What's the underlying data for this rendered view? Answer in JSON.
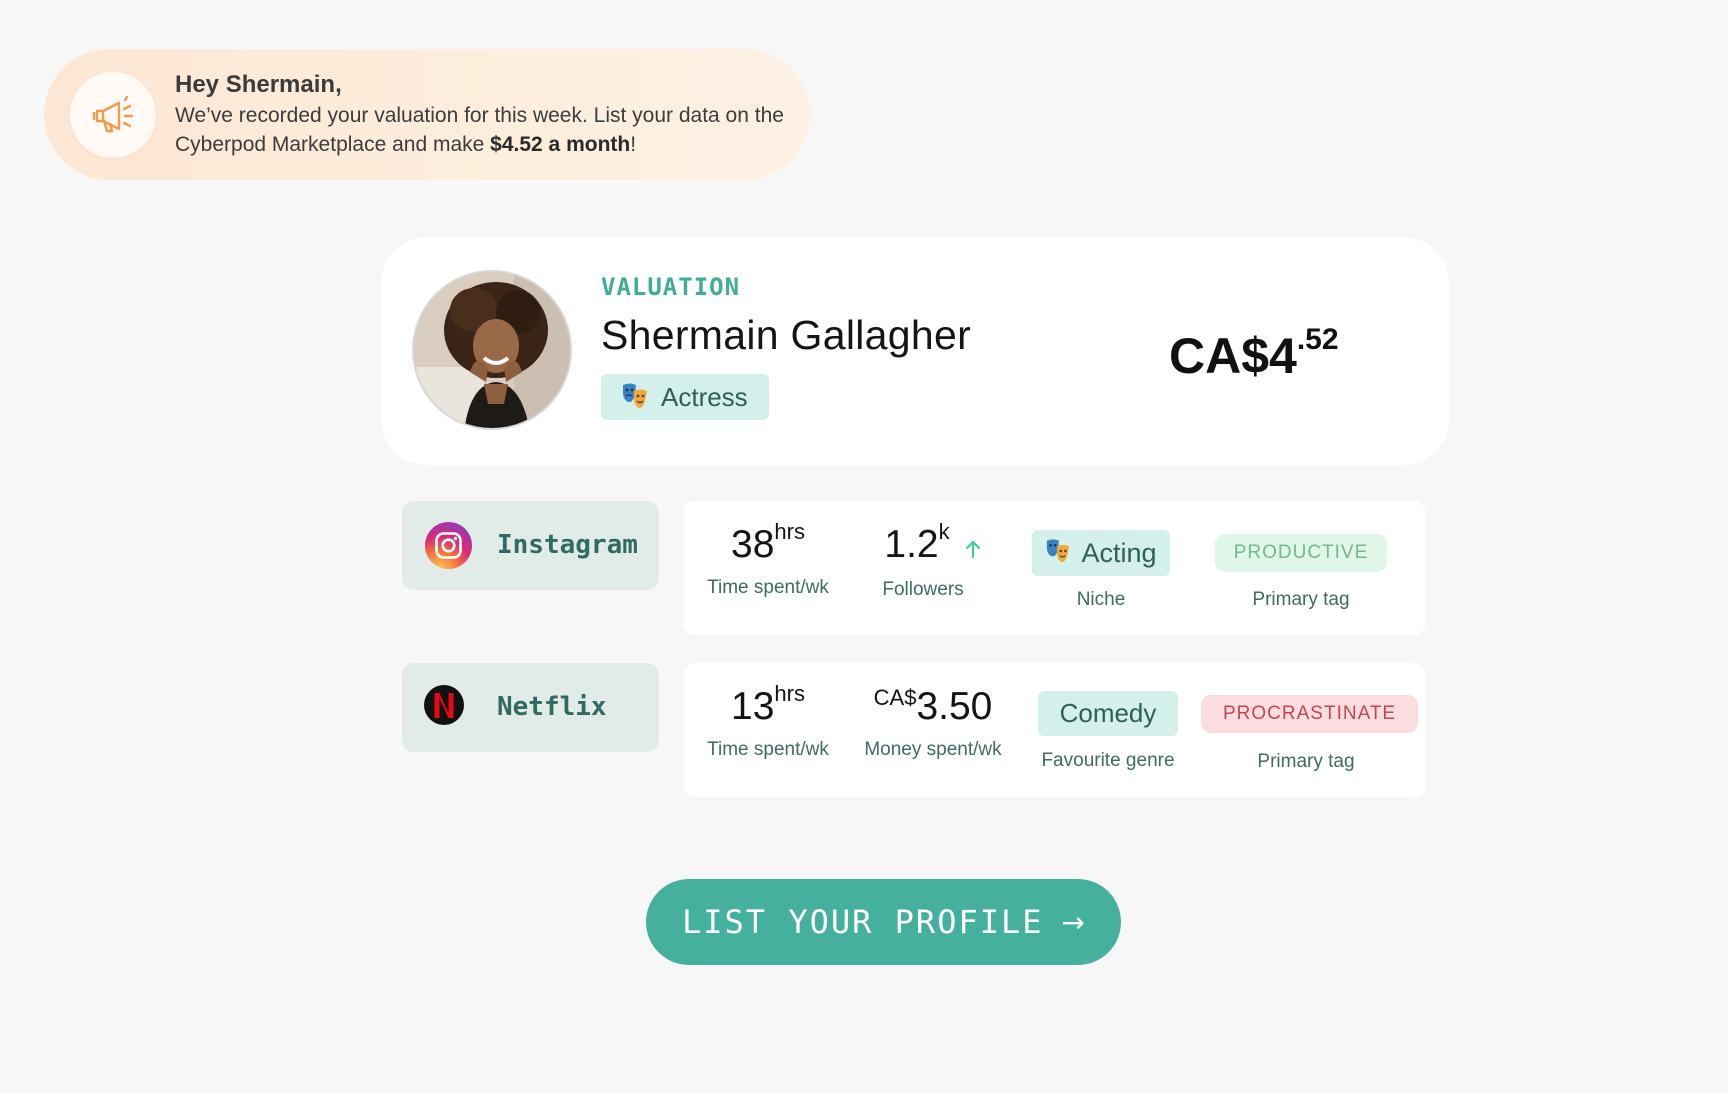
{
  "banner": {
    "greeting": "Hey Shermain,",
    "message_prefix": "We’ve recorded your valuation for this week. List your data on the Cyberpod Marketplace and make ",
    "message_highlight": "$4.52 a month",
    "message_suffix": "!",
    "icon": "megaphone-icon",
    "accent_color": "#f5a05a"
  },
  "valuation": {
    "label": "VALUATION",
    "name": "Shermain Gallagher",
    "role_icon": "theater-masks-icon",
    "role": "Actress",
    "amount_main": "CA$4",
    "amount_cents": ".52"
  },
  "services": [
    {
      "name": "Instagram",
      "icon": "instagram-icon",
      "stats": [
        {
          "value": "38",
          "unit": "hrs",
          "label": "Time spent/wk"
        },
        {
          "value": "1.2",
          "unit": "k",
          "trend": "up",
          "label": "Followers"
        },
        {
          "chip": "Acting",
          "chip_icon": "theater-masks-icon",
          "label": "Niche"
        },
        {
          "tag": "PRODUCTIVE",
          "label": "Primary tag"
        }
      ]
    },
    {
      "name": "Netflix",
      "icon": "netflix-icon",
      "stats": [
        {
          "value": "13",
          "unit": "hrs",
          "label": "Time spent/wk"
        },
        {
          "prefix": "CA$",
          "value": "3.50",
          "label": "Money spent/wk"
        },
        {
          "chip": "Comedy",
          "label": "Favourite genre"
        },
        {
          "tag": "PROCRASTINATE",
          "label": "Primary tag"
        }
      ]
    }
  ],
  "cta": {
    "label": "LIST YOUR PROFILE",
    "arrow": "→",
    "color": "#45b09e"
  },
  "colors": {
    "accent_teal": "#3fae99",
    "chip_bg": "#d4f0ea",
    "productive": "#71b98c",
    "procrastinate": "#c2484f"
  }
}
